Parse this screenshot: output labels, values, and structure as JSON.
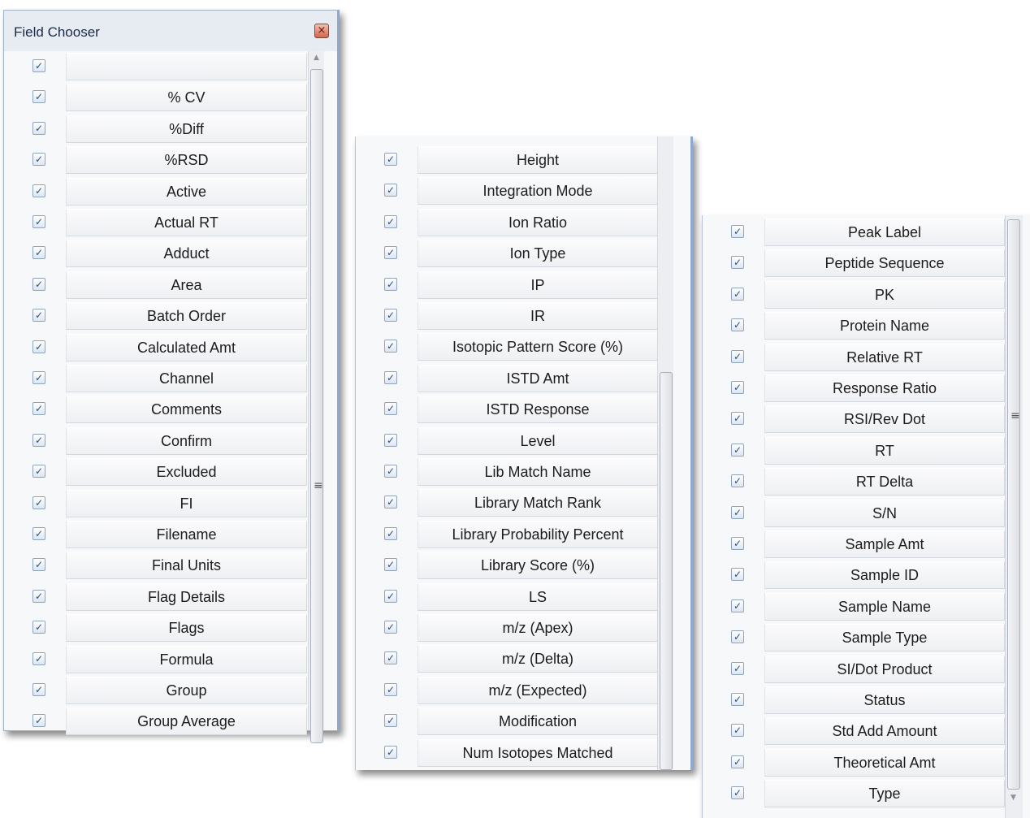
{
  "panel1": {
    "title": "Field Chooser",
    "close_glyph": "×",
    "rows": [
      {
        "label": "",
        "checked": true
      },
      {
        "label": "% CV",
        "checked": true
      },
      {
        "label": "%Diff",
        "checked": true
      },
      {
        "label": "%RSD",
        "checked": true
      },
      {
        "label": "Active",
        "checked": true
      },
      {
        "label": "Actual RT",
        "checked": true
      },
      {
        "label": "Adduct",
        "checked": true
      },
      {
        "label": "Area",
        "checked": true
      },
      {
        "label": "Batch Order",
        "checked": true
      },
      {
        "label": "Calculated Amt",
        "checked": true
      },
      {
        "label": "Channel",
        "checked": true
      },
      {
        "label": "Comments",
        "checked": true
      },
      {
        "label": "Confirm",
        "checked": true
      },
      {
        "label": "Excluded",
        "checked": true
      },
      {
        "label": "FI",
        "checked": true
      },
      {
        "label": "Filename",
        "checked": true
      },
      {
        "label": "Final Units",
        "checked": true
      },
      {
        "label": "Flag Details",
        "checked": true
      },
      {
        "label": "Flags",
        "checked": true
      },
      {
        "label": "Formula",
        "checked": true
      },
      {
        "label": "Group",
        "checked": true
      },
      {
        "label": "Group Average",
        "checked": true
      }
    ]
  },
  "panel2": {
    "rows": [
      {
        "label": "Height",
        "checked": true
      },
      {
        "label": "Integration Mode",
        "checked": true
      },
      {
        "label": "Ion Ratio",
        "checked": true
      },
      {
        "label": "Ion Type",
        "checked": true
      },
      {
        "label": "IP",
        "checked": true
      },
      {
        "label": "IR",
        "checked": true
      },
      {
        "label": "Isotopic Pattern Score (%)",
        "checked": true
      },
      {
        "label": "ISTD Amt",
        "checked": true
      },
      {
        "label": "ISTD Response",
        "checked": true
      },
      {
        "label": "Level",
        "checked": true
      },
      {
        "label": "Lib Match Name",
        "checked": true
      },
      {
        "label": "Library Match Rank",
        "checked": true
      },
      {
        "label": "Library Probability Percent",
        "checked": true
      },
      {
        "label": "Library Score (%)",
        "checked": true
      },
      {
        "label": "LS",
        "checked": true
      },
      {
        "label": "m/z (Apex)",
        "checked": true
      },
      {
        "label": "m/z (Delta)",
        "checked": true
      },
      {
        "label": "m/z (Expected)",
        "checked": true
      },
      {
        "label": "Modification",
        "checked": true
      },
      {
        "label": "Num Isotopes Matched",
        "checked": true
      }
    ]
  },
  "panel3": {
    "rows": [
      {
        "label": "Peak Label",
        "checked": true
      },
      {
        "label": "Peptide Sequence",
        "checked": true
      },
      {
        "label": "PK",
        "checked": true
      },
      {
        "label": "Protein Name",
        "checked": true
      },
      {
        "label": "Relative RT",
        "checked": true
      },
      {
        "label": "Response Ratio",
        "checked": true
      },
      {
        "label": "RSI/Rev Dot",
        "checked": true
      },
      {
        "label": "RT",
        "checked": true
      },
      {
        "label": "RT Delta",
        "checked": true
      },
      {
        "label": "S/N",
        "checked": true
      },
      {
        "label": "Sample Amt",
        "checked": true
      },
      {
        "label": "Sample ID",
        "checked": true
      },
      {
        "label": "Sample Name",
        "checked": true
      },
      {
        "label": "Sample Type",
        "checked": true
      },
      {
        "label": "SI/Dot Product",
        "checked": true
      },
      {
        "label": "Status",
        "checked": true
      },
      {
        "label": "Std Add Amount",
        "checked": true
      },
      {
        "label": "Theoretical Amt",
        "checked": true
      },
      {
        "label": "Type",
        "checked": true
      }
    ]
  },
  "icons": {
    "checkmark": "✓",
    "grip": "≡",
    "scroll_up": "▲",
    "scroll_down": "▼"
  }
}
